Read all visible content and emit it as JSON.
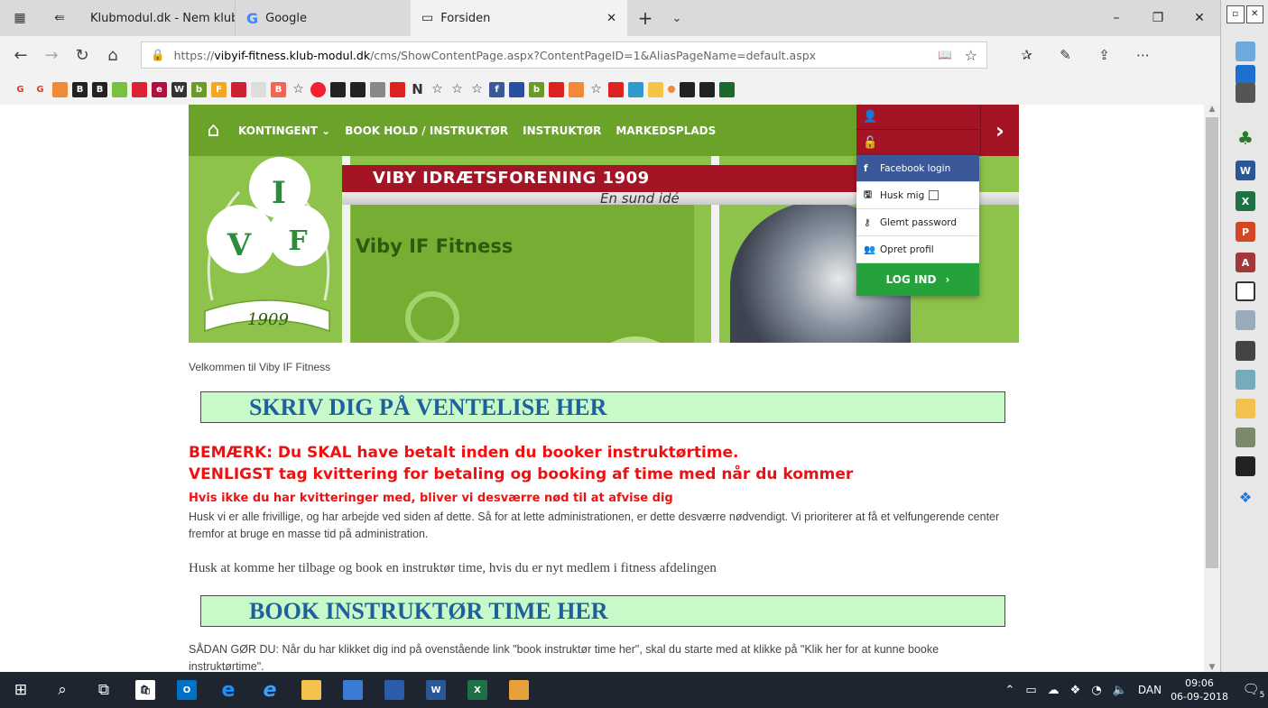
{
  "tabs": {
    "tab1": "Klubmodul.dk - Nem klubac",
    "tab2": "Google",
    "tab3": "Forsiden"
  },
  "address": {
    "scheme": "https://",
    "host": "vibyif-fitness.klub-modul.dk",
    "path": "/cms/ShowContentPage.aspx?ContentPageID=1&AliasPageName=default.aspx"
  },
  "site": {
    "nav": [
      "KONTINGENT",
      "BOOK HOLD / INSTRUKTØR",
      "INSTRUKTØR",
      "MARKEDSPLADS"
    ],
    "banner_title": "VIBY IDRÆTSFORENING 1909",
    "banner_motto": "En sund idé",
    "banner_name": "Viby IF Fitness",
    "logo_letters": [
      "I",
      "V",
      "F"
    ],
    "logo_year": "1909"
  },
  "login": {
    "facebook": "Facebook login",
    "remember": "Husk mig",
    "forgot": "Glemt password",
    "create": "Opret profil",
    "submit": "LOG IND"
  },
  "content": {
    "welcome": "Velkommen til Viby IF Fitness",
    "box1": "SKRIV DIG PÅ VENTELISE HER",
    "red1": "BEMÆRK: Du SKAL have betalt inden du booker instruktørtime.",
    "red2": "VENLIGST tag kvittering for betaling og booking af time med når du kommer",
    "red3": "Hvis ikke du har kvitteringer med, bliver vi desværre nød til at afvise dig",
    "para1": "Husk vi er alle frivillige, og har arbejde ved siden af dette. Så for at lette administrationen, er dette desværre nødvendigt. Vi prioriterer at få et velfungerende center fremfor at bruge en masse tid på administration.",
    "para2": "Husk at komme her tilbage og book en instruktør time, hvis du er nyt medlem i fitness afdelingen",
    "box2": "BOOK INSTRUKTØR TIME HER",
    "para3": "SÅDAN GØR DU: Når du har klikket dig ind på ovenstående link \"book instruktør time her\", skal du starte med at klikke på \"Klik her for at kunne booke instruktørtime\"."
  },
  "taskbar": {
    "lang": "DAN",
    "time": "09:06",
    "date": "06-09-2018",
    "notifications": "5"
  },
  "colors": {
    "nav_green": "#6aa22a",
    "club_red": "#a41424",
    "box_green": "#c8f9c8",
    "link_blue": "#1f5f9f",
    "warn_red": "#e11111"
  }
}
